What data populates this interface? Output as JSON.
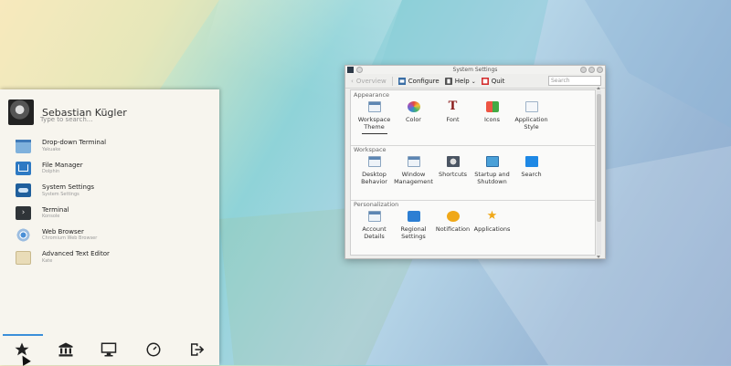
{
  "launcher": {
    "user_name": "Sebastian Kügler",
    "search_placeholder": "Type to search...",
    "favorites": [
      {
        "name": "Drop-down Terminal",
        "sub": "Yakuake",
        "icon": "terminal-dropdown-icon"
      },
      {
        "name": "File Manager",
        "sub": "Dolphin",
        "icon": "folder-icon"
      },
      {
        "name": "System Settings",
        "sub": "System Settings",
        "icon": "settings-icon"
      },
      {
        "name": "Terminal",
        "sub": "Konsole",
        "icon": "terminal-icon"
      },
      {
        "name": "Web Browser",
        "sub": "Chromium Web Browser",
        "icon": "browser-icon"
      },
      {
        "name": "Advanced Text Editor",
        "sub": "Kate",
        "icon": "text-editor-icon"
      }
    ],
    "tabs": [
      {
        "icon": "star-icon",
        "label": "Favorites"
      },
      {
        "icon": "applications-icon",
        "label": "Applications"
      },
      {
        "icon": "computer-icon",
        "label": "Computer"
      },
      {
        "icon": "history-icon",
        "label": "History"
      },
      {
        "icon": "leave-icon",
        "label": "Leave"
      }
    ]
  },
  "window": {
    "title": "System Settings",
    "toolbar": {
      "overview": "Overview",
      "configure": "Configure",
      "help": "Help",
      "quit": "Quit"
    },
    "search_placeholder": "Search",
    "sections": [
      {
        "title": "Appearance",
        "items": [
          {
            "label": "Workspace\nTheme",
            "icon": "workspace-theme-icon"
          },
          {
            "label": "Color",
            "icon": "color-icon"
          },
          {
            "label": "Font",
            "icon": "font-icon"
          },
          {
            "label": "Icons",
            "icon": "icons-icon"
          },
          {
            "label": "Application\nStyle",
            "icon": "application-style-icon"
          }
        ]
      },
      {
        "title": "Workspace",
        "items": [
          {
            "label": "Desktop\nBehavior",
            "icon": "desktop-behavior-icon"
          },
          {
            "label": "Window\nManagement",
            "icon": "window-management-icon"
          },
          {
            "label": "Shortcuts",
            "icon": "shortcuts-icon"
          },
          {
            "label": "Startup and\nShutdown",
            "icon": "startup-shutdown-icon"
          },
          {
            "label": "Search",
            "icon": "search-icon"
          }
        ]
      },
      {
        "title": "Personalization",
        "items": [
          {
            "label": "Account\nDetails",
            "icon": "account-details-icon"
          },
          {
            "label": "Regional\nSettings",
            "icon": "regional-settings-icon"
          },
          {
            "label": "Notification",
            "icon": "notification-icon"
          },
          {
            "label": "Applications",
            "icon": "applications-icon"
          }
        ]
      }
    ]
  }
}
